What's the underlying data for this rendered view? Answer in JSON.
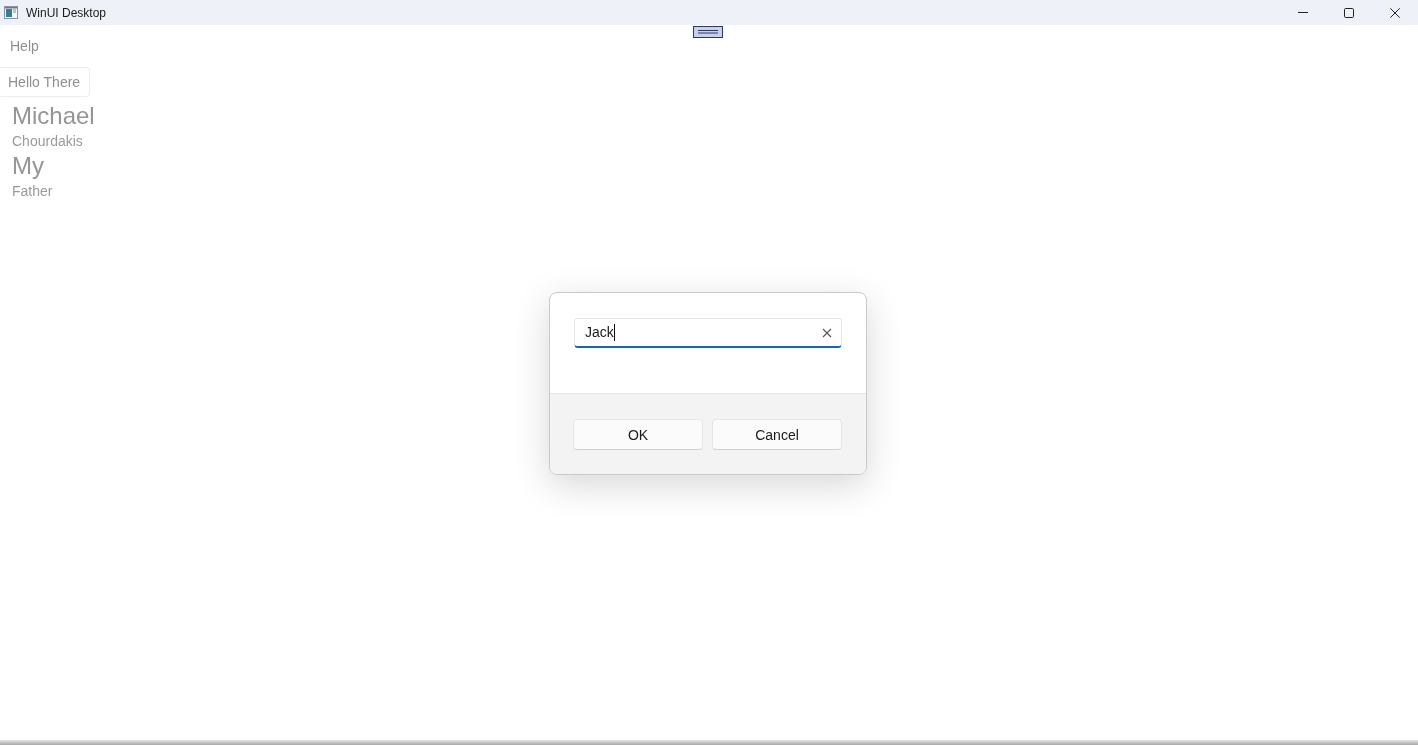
{
  "window": {
    "title": "WinUI Desktop"
  },
  "menu_bar": {
    "items": [
      {
        "label": "Help"
      }
    ]
  },
  "content": {
    "button": "Hello There",
    "entries": [
      {
        "title": "Michael",
        "subtitle": "Chourdakis"
      },
      {
        "title": "My",
        "subtitle": "Father"
      }
    ]
  },
  "dialog": {
    "text_field": {
      "value": "Jack",
      "focused": true
    },
    "buttons": [
      "OK",
      "Cancel"
    ]
  }
}
